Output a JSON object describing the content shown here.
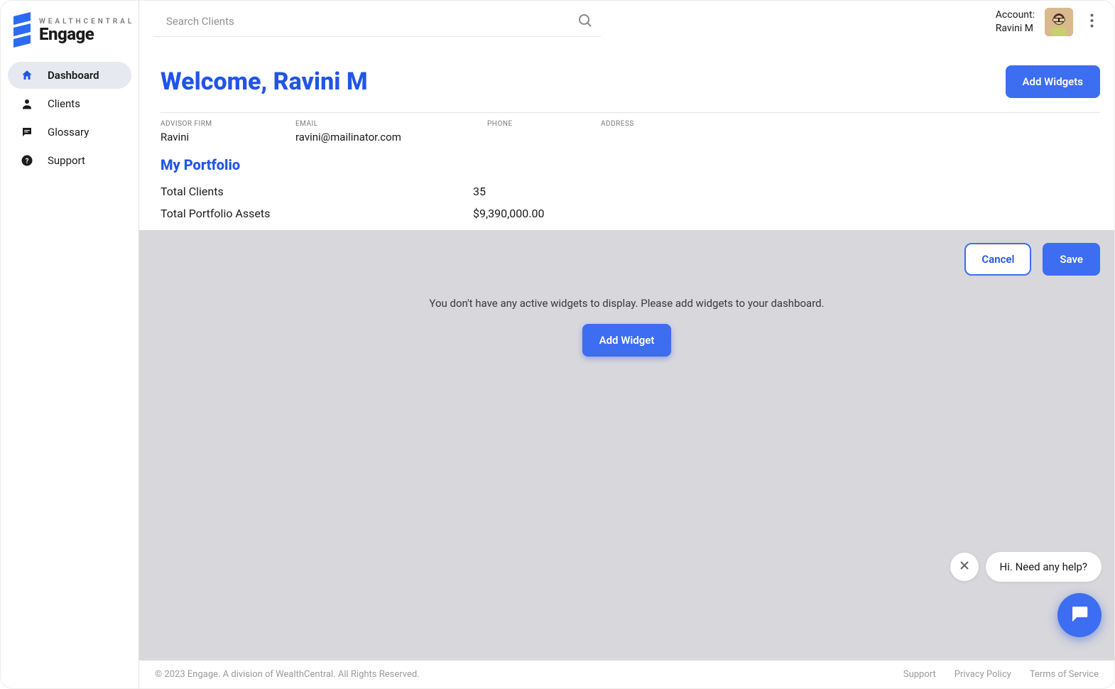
{
  "brand": {
    "small": "WEALTHCENTRAL",
    "big": "Engage"
  },
  "sidebar": {
    "items": [
      {
        "label": "Dashboard",
        "icon": "home-icon",
        "active": true
      },
      {
        "label": "Clients",
        "icon": "user-icon",
        "active": false
      },
      {
        "label": "Glossary",
        "icon": "chat-icon",
        "active": false
      },
      {
        "label": "Support",
        "icon": "help-icon",
        "active": false
      }
    ]
  },
  "search": {
    "placeholder": "Search Clients"
  },
  "account": {
    "label": "Account:",
    "name": "Ravini M"
  },
  "welcome": {
    "title": "Welcome, Ravini M",
    "add_widgets": "Add Widgets"
  },
  "info": {
    "advisor_firm_label": "ADVISOR FIRM",
    "advisor_firm_value": "Ravini",
    "email_label": "EMAIL",
    "email_value": "ravini@mailinator.com",
    "phone_label": "PHONE",
    "phone_value": "",
    "address_label": "ADDRESS",
    "address_value": ""
  },
  "portfolio": {
    "title": "My Portfolio",
    "rows": [
      {
        "k": "Total Clients",
        "v": "35"
      },
      {
        "k": "Total Portfolio Assets",
        "v": "$9,390,000.00"
      }
    ]
  },
  "widget_area": {
    "cancel": "Cancel",
    "save": "Save",
    "empty_text": "You don't have any active widgets to display. Please add widgets to your dashboard.",
    "add_widget": "Add Widget"
  },
  "help": {
    "bubble": "Hi. Need any help?"
  },
  "footer": {
    "copyright": "© 2023 Engage. A division of WealthCentral. All Rights Reserved.",
    "links": [
      "Support",
      "Privacy Policy",
      "Terms of Service"
    ]
  }
}
